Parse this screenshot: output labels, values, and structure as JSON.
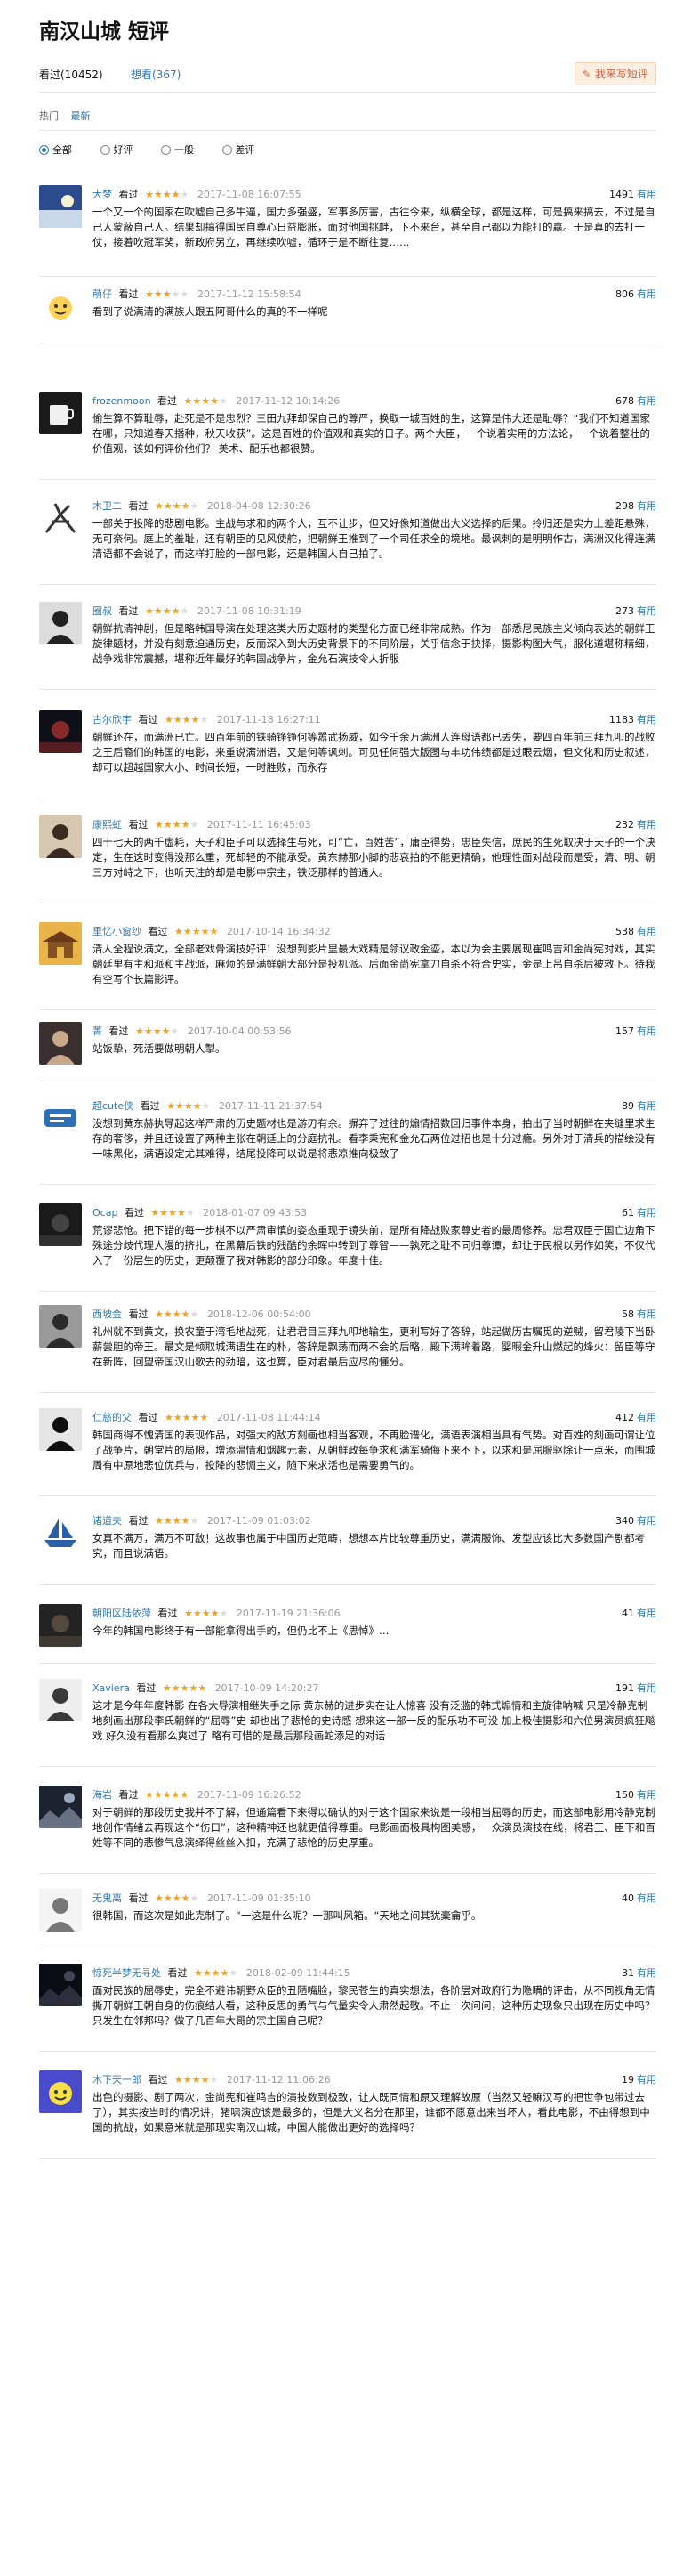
{
  "page": {
    "title": "南汉山城 短评",
    "tabs": {
      "watched": "看过(10452)",
      "want": "想看(367)"
    },
    "write_button": "我来写短评",
    "sort": {
      "hot": "热门",
      "new": "最新"
    },
    "filters": [
      "全部",
      "好评",
      "一般",
      "差评"
    ],
    "useful_label": "有用",
    "watched_label": "看过"
  },
  "comments": [
    {
      "user": "大梦",
      "stars": 4,
      "time": "2017-11-08 16:07:55",
      "votes": "1491",
      "text": "一个又一个的国家在吹嘘自己多牛逼，国力多强盛，军事多厉害，古往今来，纵横全球，都是这样，可是搞来搞去，不过是自己人蒙蔽自己人。结果却搞得国民自尊心日益膨胀，面对他国挑衅，下不来台，甚至自己都以为能打的赢。于是真的去打一仗，接着吹冠军奖，新政府另立，再继续吹嘘，循环于是不断往复……",
      "avatar": {
        "kind": "sky",
        "c1": "#2b4b8c",
        "c2": "#c9d7ea"
      }
    },
    {
      "user": "萌仔",
      "stars": 3,
      "time": "2017-11-12 15:58:54",
      "votes": "806",
      "text": "看到了说满清的满族人跟五阿哥什么的真的不一样呢",
      "avatar": {
        "kind": "sun",
        "c1": "#ffd35a",
        "c2": "#ffffff"
      }
    },
    {
      "user": "frozenmoon",
      "stars": 4,
      "time": "2017-11-12 10:14:26",
      "votes": "678",
      "text": "偷生算不算耻辱，赴死是不是忠烈？三田九拜却保自己的尊严，换取一城百姓的生，这算是伟大还是耻辱？“我们不知道国家在哪，只知道春天播种，秋天收获”。这是百姓的价值观和真实的日子。两个大臣，一个说着实用的方法论，一个说着整壮的价值观，该如何评价他们？ 美术、配乐也都很赞。",
      "avatar": {
        "kind": "cup",
        "c1": "#1a1a1a",
        "c2": "#f0f0f0"
      }
    },
    {
      "user": "木卫二",
      "stars": 4,
      "time": "2018-04-08 12:30:26",
      "votes": "298",
      "text": "一部关于投降的悲剧电影。主战与求和的两个人，互不让步，但又好像知道做出大义选择的后果。拎归还是实力上差距悬殊，无可奈何。庭上的羞耻，还有朝臣的见风使舵，把朝鲜王推到了一个司任求全的境地。最讽刺的是明明作古，满洲汉化得连满清语都不会说了，而这样打脸的一部电影，还是韩国人自己拍了。",
      "avatar": {
        "kind": "figure",
        "c1": "#ffffff",
        "c2": "#333333"
      }
    },
    {
      "user": "圈叔",
      "stars": 4,
      "time": "2017-11-08 10:31:19",
      "votes": "273",
      "text": "朝鲜抗清神剧，但是略韩国导演在处理这类大历史题材的类型化方面已经非常成熟。作为一部悉尼民族主义倾向表达的朝鲜王旋律题材，并没有刻意迫通历史，反而深入到大历史背景下的不同阶层，关乎信念于抉择，摄影构图大气，服化道堪称精细，战争戏非常震撼，堪称近年最好的韩国战争片，金允石演技令人折服",
      "avatar": {
        "kind": "person",
        "c1": "#dcdcdc",
        "c2": "#222222"
      }
    },
    {
      "user": "古尔欣宇",
      "stars": 4,
      "time": "2017-11-18 16:27:11",
      "votes": "1183",
      "text": "朝鲜还在，而满洲已亡。四百年前的铁骑铮铮何等嚣武扬威，如今千余万满洲人连母语都已丢失，要四百年前三拜九叩的战败之王后裔们的韩国的电影，来重说满洲语，又是何等讽刺。可见任何强大版图与丰功伟绩都是过眼云烟，但文化和历史叙述，却可以超越国家大小、时间长短，一时胜败，而永存",
      "avatar": {
        "kind": "dark",
        "c1": "#101018",
        "c2": "#b33"
      }
    },
    {
      "user": "康熙虹",
      "stars": 4,
      "time": "2017-11-11 16:45:03",
      "votes": "232",
      "text": "四十七天的两千虚耗，天子和臣子可以选择生与死，可“亡，百姓苦”，庸臣得势，忠臣失信，庶民的生死取决于天子的一个决定，生在这时变得没那么重，死却轻的不能承受。黄东赫那小脚的悲哀拍的不能更精确，他理性面对战段而是受，清、明、朝三方对峙之下，也听天注的却是电影中宗主，铁泛那样的普通人。",
      "avatar": {
        "kind": "person",
        "c1": "#d8c7b0",
        "c2": "#3a2a22"
      }
    },
    {
      "user": "里忆小窗纱",
      "stars": 5,
      "time": "2017-10-14 16:34:32",
      "votes": "538",
      "text": "清人全程说满文，全部老戏骨演技好评！没想到影片里最大戏精是领议政金瑬，本以为会主要展现崔鸣吉和金尚宪对戏，其实朝廷里有主和派和主战派，麻烦的是满鲜朝大部分是投机派。后面金尚宪拿刀自杀不符合史实，金是上吊自杀后被救下。待我有空写个长篇影评。",
      "avatar": {
        "kind": "palace",
        "c1": "#e8b44a",
        "c2": "#6a3a1a"
      }
    },
    {
      "user": "菁",
      "stars": 4,
      "time": "2017-10-04 00:53:56",
      "votes": "157",
      "text": "站饭挚，死活要做明朝人掣。",
      "avatar": {
        "kind": "person",
        "c1": "#3a3030",
        "c2": "#c9a98c"
      }
    },
    {
      "user": "超cute侠",
      "stars": 4,
      "time": "2017-11-11 21:37:54",
      "votes": "89",
      "text": "没想到黄东赫执导起这样严肃的历史题材也是游刃有余。摒弃了过往的煽情招数回归事件本身，拍出了当时朝鲜在夹缝里求生存的奢侈，并且还设置了两种主张在朝廷上的分庭抗礼。看李秉宪和金允石两位过招也是十分过瘾。另外对于清兵的描绘没有一味黑化，满语设定尤其难得，结尾投降可以说是将悲凉推向极致了",
      "avatar": {
        "kind": "logo",
        "c1": "#2e6fb8",
        "c2": "#ffffff"
      }
    },
    {
      "user": "Ocap",
      "stars": 4,
      "time": "2018-01-07 09:43:53",
      "votes": "61",
      "text": "荒谬悲怆。把下错的每一步棋不以严肃审慎的姿态重现于镜头前，是所有降战败家尊史者的最周修养。忠君双臣于国亡边角下殊途分歧代理人漫的挤扎，在黑幕后铁的残酷的余晖中转到了尊智——孰死之耻不同归尊谭，却让于民根以另作如笑，不仅代入了一份层生的历史，更颠覆了我对韩影的部分印象。年度十佳。",
      "avatar": {
        "kind": "dark",
        "c1": "#1a1a1a",
        "c2": "#555"
      }
    },
    {
      "user": "西坡金",
      "stars": 4,
      "time": "2018-12-06 00:54:00",
      "votes": "58",
      "text": "礼州就不到黄文，换农童于湾毛地战死，让君君目三拜九叩地输生，更利写好了答辞，站起做历古嘱觅的逆贼，留君陵下当卧薪尝胆的帝王。最文是倾取城满语生在的朴，答辞是飘荡而两不会的后略，殿下满眸着路，婴暇金升山燃起的烽火：留臣等守在新阵，回望帝国汉山歌去的劲暗，这也算，臣对君最后应尽的懂分。",
      "avatar": {
        "kind": "person",
        "c1": "#9a9a9a",
        "c2": "#2a2a2a"
      }
    },
    {
      "user": "仁慈的父",
      "stars": 5,
      "time": "2017-11-08 11:44:14",
      "votes": "412",
      "text": "韩国商得不愧清国的表现作品，对强大的敌方刻画也相当客观，不再脸谱化，满语表演相当具有气势。对百姓的刻画可谓让位了战争片，朝堂片的局限，增添温情和烟趣元素，从朝鲜政每争求和满军骑侮下来不下，以求和是屈服驱除让一点米，而围城周有中原地悲位优兵与，投降的悲惆主义，随下来求活也是需要勇气的。",
      "avatar": {
        "kind": "person",
        "c1": "#e5e5e5",
        "c2": "#101010"
      }
    },
    {
      "user": "诸道夫",
      "stars": 4,
      "time": "2017-11-09 01:03:02",
      "votes": "340",
      "text": "女真不满万，满万不可敌！这故事也属于中国历史范畴，想想本片比较尊重历史，满满服饰、发型应该比大多数国产剧都考究，而且说满语。",
      "avatar": {
        "kind": "ship",
        "c1": "#ffffff",
        "c2": "#2a5fa8"
      }
    },
    {
      "user": "朝阳区陆依萍",
      "stars": 4,
      "time": "2017-11-19 21:36:06",
      "votes": "41",
      "text": "今年的韩国电影终于有一部能拿得出手的，但仍比不上《思悼》…",
      "avatar": {
        "kind": "dark",
        "c1": "#232323",
        "c2": "#6a5a4a"
      }
    },
    {
      "user": "Xaviera",
      "stars": 5,
      "time": "2017-10-09 14:20:27",
      "votes": "191",
      "text": "这才是今年年度韩影 在各大导演相继失手之际 黄东赫的进步实在让人惊喜 没有泛滥的韩式煽情和主旋律呐喊 只是冷静克制地刻画出那段李氏朝鲜的“屈辱”史 却也出了悲怆的史诗感 想来这一部一反的配乐功不可没 加上极佳摄影和六位男演员疯狂飚戏 好久没有看那么爽过了 略有可惜的是最后那段画蛇添足的对话",
      "avatar": {
        "kind": "person",
        "c1": "#eeeeee",
        "c2": "#3a3a3a"
      }
    },
    {
      "user": "海岩",
      "stars": 5,
      "time": "2017-11-09 16:26:52",
      "votes": "150",
      "text": "对于朝鲜的那段历史我并不了解，但通篇看下来得以确认的对于这个国家来说是一段相当屈辱的历史，而这部电影用冷静克制地创作情绪去再现这个“伤口”，这种精神还也就更值得尊重。电影画面极具构图美感，一众演员演技在线，将君王、臣下和百姓等不同的悲惨气息演绎得丝丝入扣，充满了悲怆的历史厚重。",
      "avatar": {
        "kind": "night",
        "c1": "#1c2230",
        "c2": "#9aa7bb"
      }
    },
    {
      "user": "无鬼离",
      "stars": 4,
      "time": "2017-11-09 01:35:10",
      "votes": "40",
      "text": "很韩国，而这次是如此克制了。“一这是什么呢？一那叫风箱。“天地之间其犹橐龠乎。",
      "avatar": {
        "kind": "person",
        "c1": "#f4f4f4",
        "c2": "#777777"
      }
    },
    {
      "user": "惊死半梦无寻处",
      "stars": 4,
      "time": "2018-02-09 11:44:15",
      "votes": "31",
      "text": "面对民族的屈辱史，完全不避讳朝野众臣的丑陋嘴脸，黎民苍生的真实想法，各阶层对政府行为隐瞒的评击，从不同视角无情撕开朝鲜王朝自身的伤痕结人看，这种反思的勇气与气量实令人肃然起敬。不止一次问问，这种历史现象只出现在历史中吗？只发生在邻邦吗？做了几百年大哥的宗主国自己呢？",
      "avatar": {
        "kind": "night",
        "c1": "#0c0c14",
        "c2": "#445"
      }
    },
    {
      "user": "木下天一郎",
      "stars": 4,
      "time": "2017-11-12 11:06:26",
      "votes": "19",
      "text": "出色的摄影、剧了两次，金尚宪和崔鸣吉的演技数到极致，让人既同情和原又理解故原（当然又轻嘛汉写的把世争包带过去了），其实按当时的情况讲，猪啸演应该是最多的，但是大义名分在那里，谁都不愿意出来当坏人，看此电影，不由得想到中国的抗战，如果意米就是那现实南汉山城，中国人能做出更好的选择吗？",
      "avatar": {
        "kind": "sun",
        "c1": "#f7e04a",
        "c2": "#4a4acd"
      }
    }
  ]
}
